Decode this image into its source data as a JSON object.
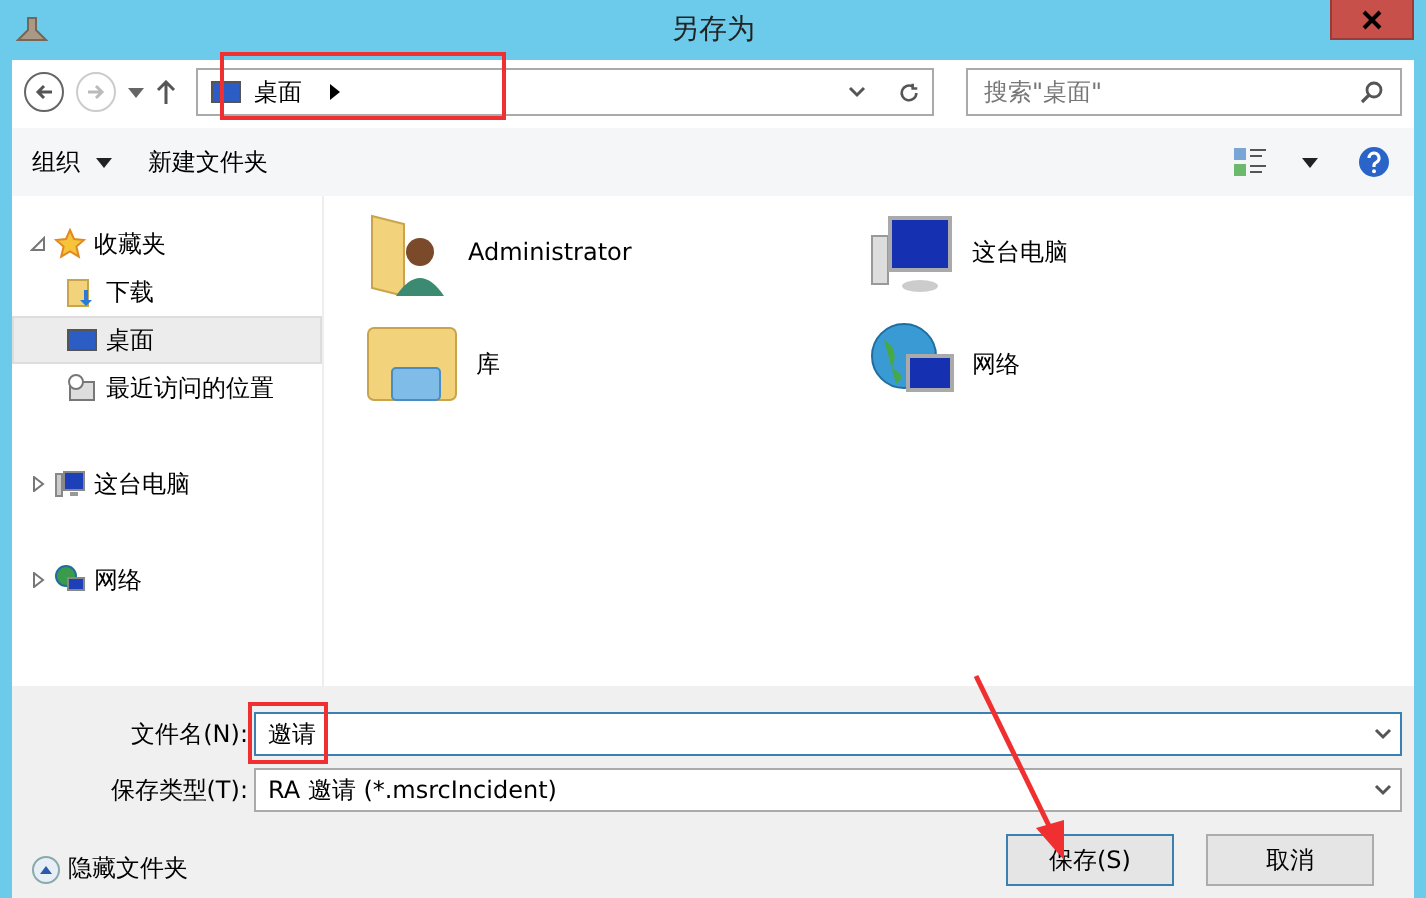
{
  "window": {
    "title": "另存为"
  },
  "address_bar": {
    "location": "桌面",
    "search_placeholder": "搜索\"桌面\""
  },
  "toolbar": {
    "organize": "组织",
    "new_folder": "新建文件夹"
  },
  "sidebar": {
    "items": [
      {
        "label": "收藏夹",
        "kind": "favorites",
        "expanded": true,
        "children": [
          {
            "label": "下载",
            "kind": "downloads",
            "selected": false
          },
          {
            "label": "桌面",
            "kind": "desktop",
            "selected": true
          },
          {
            "label": "最近访问的位置",
            "kind": "recent",
            "selected": false
          }
        ]
      },
      {
        "label": "这台电脑",
        "kind": "computer",
        "expanded": false
      },
      {
        "label": "网络",
        "kind": "network",
        "expanded": false
      }
    ]
  },
  "content": {
    "items": [
      {
        "label": "Administrator",
        "kind": "user"
      },
      {
        "label": "这台电脑",
        "kind": "computer"
      },
      {
        "label": "库",
        "kind": "library"
      },
      {
        "label": "网络",
        "kind": "network"
      }
    ]
  },
  "form": {
    "file_name_label": "文件名(N):",
    "file_name": "邀请",
    "save_type_label": "保存类型(T):",
    "save_type": "RA 邀请 (*.msrcIncident)"
  },
  "footer": {
    "hide_folders": "隐藏文件夹",
    "buttons": [
      {
        "label": "保存(S)",
        "kind": "primary"
      },
      {
        "label": "取消",
        "kind": "secondary"
      }
    ]
  }
}
